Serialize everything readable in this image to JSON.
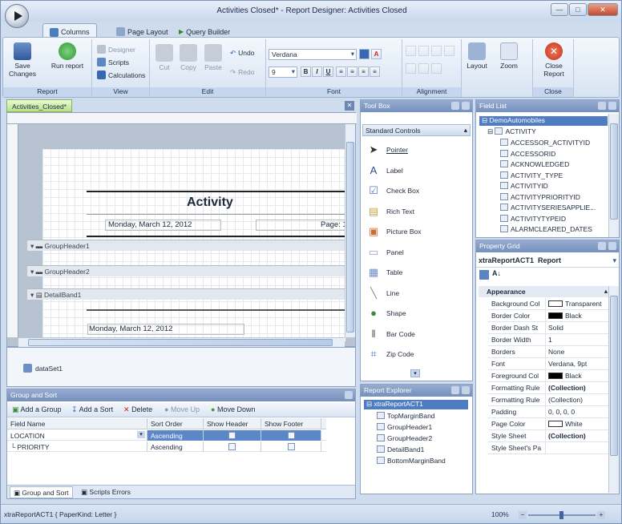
{
  "window": {
    "title": "Activities Closed* - Report Designer: Activities Closed"
  },
  "tabs": [
    "Columns",
    "Page Layout",
    "Query Builder"
  ],
  "ribbon": {
    "groups": [
      "Report",
      "View",
      "Edit",
      "Font",
      "Alignment",
      "Close"
    ],
    "save": "Save\nChanges",
    "save_l1": "Save",
    "save_l2": "Changes",
    "run": "Run report",
    "designer": "Designer",
    "scripts": "Scripts",
    "calculations": "Calculations",
    "cut": "Cut",
    "copy": "Copy",
    "paste": "Paste",
    "undo": "Undo",
    "redo": "Redo",
    "font_name": "Verdana",
    "font_size": "9",
    "layout": "Layout",
    "zoom": "Zoom",
    "close_l1": "Close",
    "close_l2": "Report"
  },
  "doc_tab": "Activities_Closed*",
  "design": {
    "title": "Activity",
    "date": "Monday, March 12, 2012",
    "page_label": "Page: 1",
    "bands": [
      "GroupHeader1",
      "GroupHeader2",
      "DetailBand1"
    ],
    "detail_date": "Monday, March 12, 2012",
    "dataset": "dataSet1"
  },
  "toolbox": {
    "title": "Tool Box",
    "category": "Standard Controls",
    "items": [
      "Pointer",
      "Label",
      "Check Box",
      "Rich Text",
      "Picture Box",
      "Panel",
      "Table",
      "Line",
      "Shape",
      "Bar Code",
      "Zip Code"
    ]
  },
  "field_list": {
    "title": "Field List",
    "root": "DemoAutomobiles",
    "table": "ACTIVITY",
    "fields": [
      "ACCESSOR_ACTIVITYID",
      "ACCESSORID",
      "ACKNOWLEDGED",
      "ACTIVITY_TYPE",
      "ACTIVITYID",
      "ACTIVITYPRIORITYID",
      "ACTIVITYSERIESAPPLIE...",
      "ACTIVITYTYPEID",
      "ALARMCLEARED_DATES"
    ]
  },
  "property_grid": {
    "title": "Property Grid",
    "object": "xtraReportACT1",
    "object_type": "Report",
    "category": "Appearance",
    "rows": [
      {
        "k": "Background Col",
        "v": "Transparent",
        "sw": "#ffffff"
      },
      {
        "k": "Border Color",
        "v": "Black",
        "sw": "#000000"
      },
      {
        "k": "Border Dash St",
        "v": "Solid",
        "sw": ""
      },
      {
        "k": "Border Width",
        "v": "1",
        "sw": ""
      },
      {
        "k": "Borders",
        "v": "None",
        "sw": ""
      },
      {
        "k": "Font",
        "v": "Verdana, 9pt",
        "sw": ""
      },
      {
        "k": "Foreground Col",
        "v": "Black",
        "sw": "#000000"
      },
      {
        "k": "Formatting Rule",
        "v": "(Collection)",
        "sw": "",
        "bold": true
      },
      {
        "k": "Formatting Rule",
        "v": "(Collection)",
        "sw": ""
      },
      {
        "k": "Padding",
        "v": "0, 0, 0, 0",
        "sw": ""
      },
      {
        "k": "Page Color",
        "v": "White",
        "sw": "#ffffff"
      },
      {
        "k": "Style Sheet",
        "v": "(Collection)",
        "sw": "",
        "bold": true
      },
      {
        "k": "Style Sheet's Pa",
        "v": "",
        "sw": ""
      }
    ]
  },
  "report_explorer": {
    "title": "Report Explorer",
    "root": "xtraReportACT1",
    "items": [
      "TopMarginBand",
      "GroupHeader1",
      "GroupHeader2",
      "DetailBand1",
      "BottomMarginBand"
    ]
  },
  "group_sort": {
    "title": "Group and Sort",
    "toolbar": [
      "Add a Group",
      "Add a Sort",
      "Delete",
      "Move Up",
      "Move Down"
    ],
    "headers": [
      "Field Name",
      "Sort Order",
      "Show Header",
      "Show Footer"
    ],
    "rows": [
      {
        "field": "LOCATION",
        "order": "Ascending"
      },
      {
        "field": "PRIORITY",
        "order": "Ascending"
      }
    ],
    "tabs": [
      "Group and Sort",
      "Scripts Errors"
    ]
  },
  "status": {
    "text": "xtraReportACT1 { PaperKind: Letter }",
    "zoom": "100%"
  }
}
